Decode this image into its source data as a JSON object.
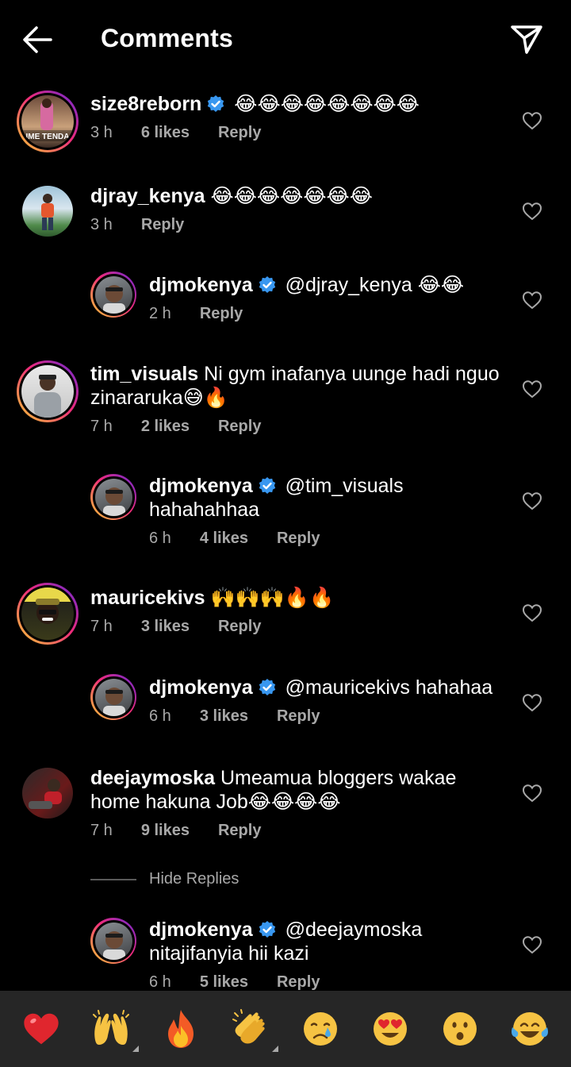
{
  "header": {
    "title": "Comments",
    "back_icon": "arrow-left-icon",
    "share_icon": "paper-plane-icon"
  },
  "comments": [
    {
      "username": "size8reborn",
      "verified": true,
      "text": "😂😂😂😂😂😂😂😂",
      "time": "3 h",
      "likes": "6 likes",
      "reply": "Reply",
      "avatar_text": "IME TENDA"
    },
    {
      "username": "djray_kenya",
      "verified": false,
      "text": "😂😂😂😂😂😂😂",
      "time": "3 h",
      "likes": "",
      "reply": "Reply"
    },
    {
      "username": "djmokenya",
      "verified": true,
      "text": "@djray_kenya 😂😂",
      "time": "2 h",
      "likes": "",
      "reply": "Reply"
    },
    {
      "username": "tim_visuals",
      "verified": false,
      "text": "Ni gym inafanya uunge hadi nguo zinararuka😅🔥",
      "time": "7 h",
      "likes": "2 likes",
      "reply": "Reply"
    },
    {
      "username": "djmokenya",
      "verified": true,
      "text": "@tim_visuals hahahahhaa",
      "time": "6 h",
      "likes": "4 likes",
      "reply": "Reply"
    },
    {
      "username": "mauricekivs",
      "verified": false,
      "text": "🙌🙌🙌🔥🔥",
      "time": "7 h",
      "likes": "3 likes",
      "reply": "Reply"
    },
    {
      "username": "djmokenya",
      "verified": true,
      "text": "@mauricekivs hahahaa",
      "time": "6 h",
      "likes": "3 likes",
      "reply": "Reply"
    },
    {
      "username": "deejaymoska",
      "verified": false,
      "text": "Umeamua bloggers wakae home hakuna Job😂😂😂😂",
      "time": "7 h",
      "likes": "9 likes",
      "reply": "Reply"
    },
    {
      "username": "djmokenya",
      "verified": true,
      "text": "@deejaymoska nitajifanyia hii kazi",
      "time": "6 h",
      "likes": "5 likes",
      "reply": "Reply"
    }
  ],
  "hide_replies": "Hide Replies",
  "emoji_bar": {
    "items": [
      "❤️",
      "🙌",
      "🔥",
      "👏",
      "😢",
      "😍",
      "😮",
      "😂"
    ]
  },
  "colors": {
    "background": "#000000",
    "meta_text": "#a8a8a8",
    "verified_blue": "#3897f0",
    "emoji_bar_bg": "#262626"
  }
}
